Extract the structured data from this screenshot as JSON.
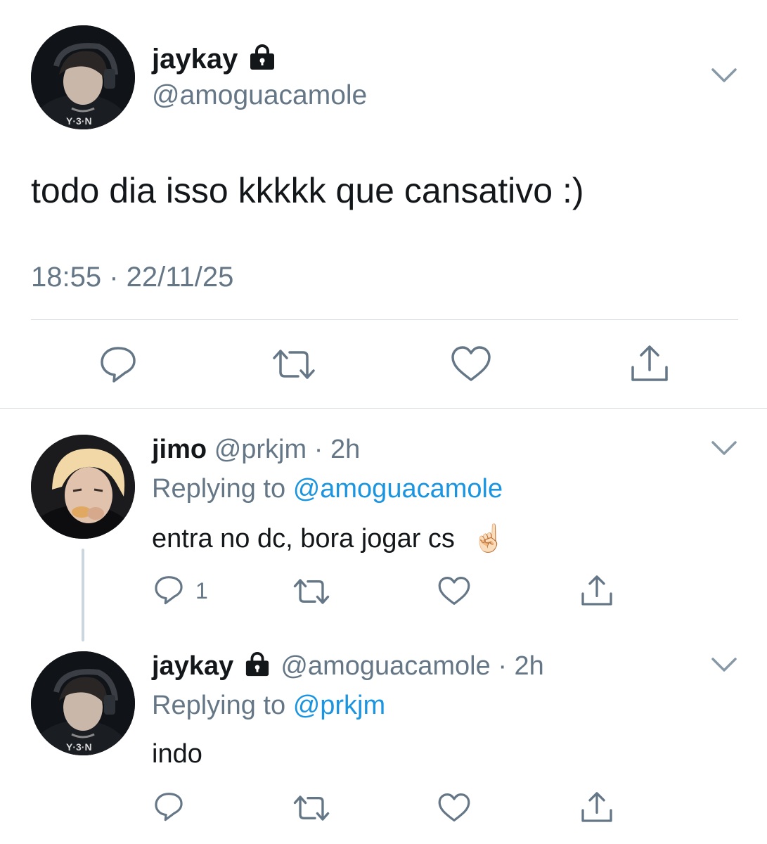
{
  "main_tweet": {
    "display_name": "jaykay",
    "handle": "@amoguacamole",
    "text": "todo dia isso kkkkk que cansativo :)",
    "timestamp": "18:55 · 22/11/25",
    "avatar_print": "Y·3·N",
    "icons": [
      "lock-icon",
      "chevron-down-icon",
      "reply-icon",
      "retweet-icon",
      "like-icon",
      "share-icon"
    ]
  },
  "reply_1": {
    "display_name": "jimo",
    "handle": "@prkjm",
    "time": "2h",
    "replying_prefix": "Replying to",
    "replying_to": "@amoguacamole",
    "text": "entra no dc, bora jogar cs",
    "emoji": "☝🏻",
    "reply_count": "1"
  },
  "reply_2": {
    "display_name": "jaykay",
    "handle": "@amoguacamole",
    "time": "2h",
    "replying_prefix": "Replying to",
    "replying_to": "@prkjm",
    "text": "indo",
    "avatar_print": "Y·3·N"
  },
  "colors": {
    "text": "#14171a",
    "secondary": "#657786",
    "link": "#1b95e0",
    "divider": "#d9dee2",
    "thread_line": "#ccd6dd"
  }
}
